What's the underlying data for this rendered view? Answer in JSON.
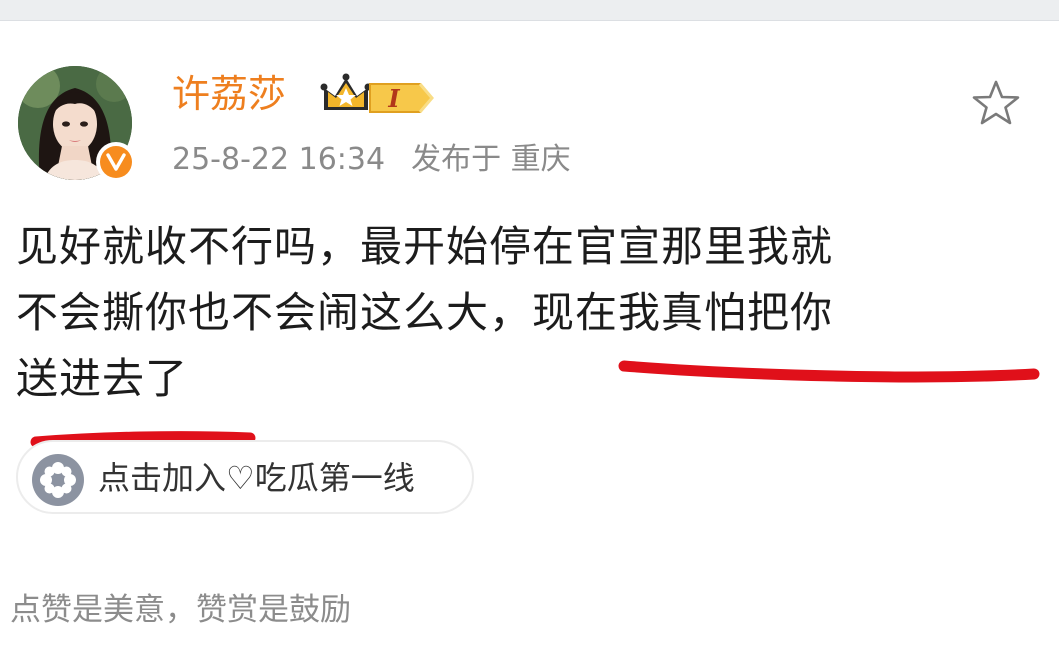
{
  "header": {
    "username": "许荔莎",
    "vip_level": "I",
    "timestamp": "25-8-22 16:34",
    "location": "发布于 重庆",
    "verified_icon": "v-verified-icon",
    "favorite_icon": "star-outline-icon"
  },
  "post": {
    "lines": [
      "见好就收不行吗，最开始停在官宣那里我就",
      "不会撕你也不会闹这么大，现在我真怕把你",
      "送进去了"
    ]
  },
  "topic": {
    "label": "点击加入♡吃瓜第一线",
    "icon": "flower-icon"
  },
  "footer": {
    "reward_text": "点赞是美意，赞赏是鼓励"
  },
  "colors": {
    "username": "#ee7f1f",
    "meta": "#8a8a8a",
    "annotation": "#e0101a",
    "verified": "#f78c1e"
  }
}
